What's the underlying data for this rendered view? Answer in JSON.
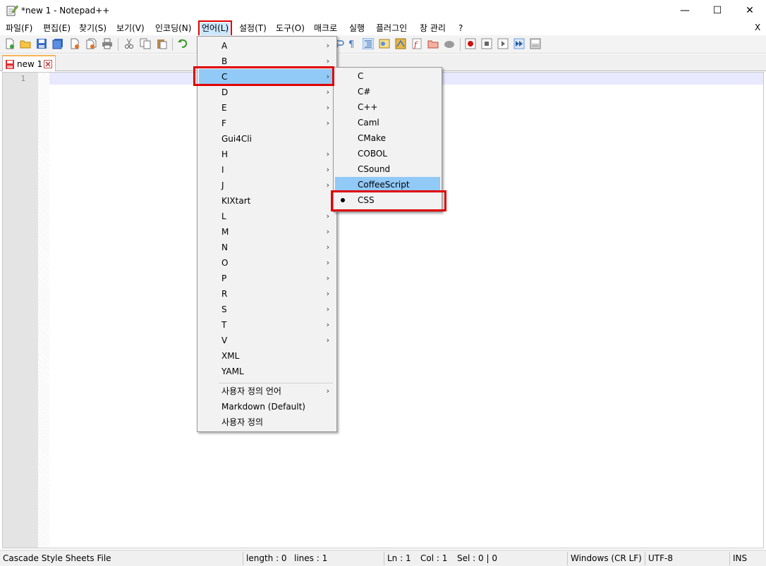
{
  "window": {
    "title": "*new 1 - Notepad++",
    "min_glyph": "—",
    "max_glyph": "☐",
    "close_glyph": "✕"
  },
  "menubar": {
    "items": [
      "파일(F)",
      "편집(E)",
      "찾기(S)",
      "보기(V)",
      "인코딩(N)",
      "언어(L)",
      "설정(T)",
      "도구(O)",
      "매크로",
      "실행",
      "플러그인",
      "창 관리",
      "?"
    ],
    "active": "언어(L)",
    "doc_close": "X"
  },
  "tabs": [
    {
      "label": "new 1"
    }
  ],
  "editor": {
    "line_numbers": [
      "1"
    ],
    "content": ""
  },
  "language_menu": {
    "items": [
      {
        "label": "A",
        "submenu": true
      },
      {
        "label": "B",
        "submenu": true
      },
      {
        "label": "C",
        "submenu": true,
        "highlighted": true
      },
      {
        "label": "D",
        "submenu": true
      },
      {
        "label": "E",
        "submenu": true
      },
      {
        "label": "F",
        "submenu": true
      },
      {
        "label": "Gui4Cli",
        "submenu": false
      },
      {
        "label": "H",
        "submenu": true
      },
      {
        "label": "I",
        "submenu": true
      },
      {
        "label": "J",
        "submenu": true
      },
      {
        "label": "KIXtart",
        "submenu": false
      },
      {
        "label": "L",
        "submenu": true
      },
      {
        "label": "M",
        "submenu": true
      },
      {
        "label": "N",
        "submenu": true
      },
      {
        "label": "O",
        "submenu": true
      },
      {
        "label": "P",
        "submenu": true
      },
      {
        "label": "R",
        "submenu": true
      },
      {
        "label": "S",
        "submenu": true
      },
      {
        "label": "T",
        "submenu": true
      },
      {
        "label": "V",
        "submenu": true
      },
      {
        "label": "XML",
        "submenu": false
      },
      {
        "label": "YAML",
        "submenu": false
      }
    ],
    "extra_items": [
      {
        "label": "사용자 정의 언어",
        "submenu": true
      },
      {
        "label": "Markdown (Default)",
        "submenu": false
      },
      {
        "label": "사용자 정의",
        "submenu": false
      }
    ]
  },
  "c_submenu": {
    "items": [
      {
        "label": "C"
      },
      {
        "label": "C#"
      },
      {
        "label": "C++"
      },
      {
        "label": "Caml"
      },
      {
        "label": "CMake"
      },
      {
        "label": "COBOL"
      },
      {
        "label": "CSound"
      },
      {
        "label": "CoffeeScript",
        "hover": true
      },
      {
        "label": "CSS",
        "checked": true
      }
    ]
  },
  "statusbar": {
    "file_type": "Cascade Style Sheets File",
    "length": "length : 0",
    "lines": "lines : 1",
    "ln": "Ln : 1",
    "col": "Col : 1",
    "sel": "Sel : 0 | 0",
    "eol": "Windows (CR LF)",
    "encoding": "UTF-8",
    "mode": "INS"
  },
  "colors": {
    "highlight": "#91c9f7",
    "callout_red": "#e00000",
    "current_line": "#e8e8ff",
    "gutter": "#e4e4e4"
  },
  "submenu_arrow": "›"
}
